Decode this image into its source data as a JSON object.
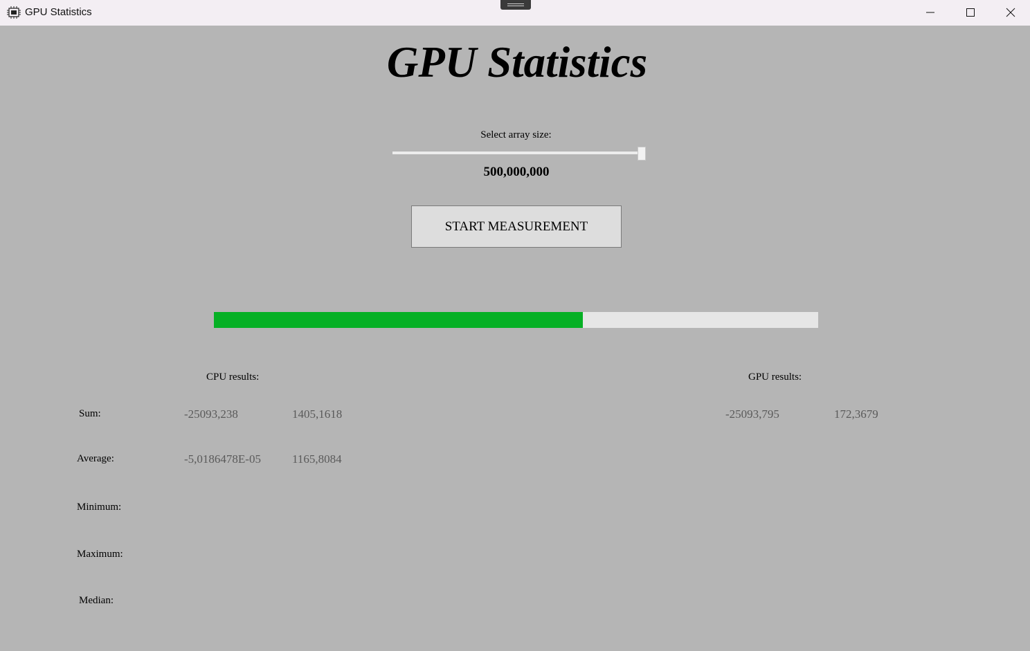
{
  "window": {
    "title": "GPU Statistics",
    "icon": "chip-icon"
  },
  "header": {
    "title": "GPU Statistics"
  },
  "array_size": {
    "label": "Select array size:",
    "value_text": "500,000,000",
    "slider_position": 0.99
  },
  "measurement": {
    "start_label": "START MEASUREMENT",
    "progress": 0.61,
    "progress_color": "#06b025"
  },
  "results": {
    "cpu_header": "CPU results:",
    "gpu_header": "GPU results:",
    "rows": [
      {
        "label": "Sum:",
        "cpu_value": "-25093,238",
        "cpu_time": "1405,1618",
        "gpu_value": "-25093,795",
        "gpu_time": "172,3679"
      },
      {
        "label": "Average:",
        "cpu_value": "-5,0186478E-05",
        "cpu_time": "1165,8084",
        "gpu_value": "",
        "gpu_time": ""
      },
      {
        "label": "Minimum:",
        "cpu_value": "",
        "cpu_time": "",
        "gpu_value": "",
        "gpu_time": ""
      },
      {
        "label": "Maximum:",
        "cpu_value": "",
        "cpu_time": "",
        "gpu_value": "",
        "gpu_time": ""
      },
      {
        "label": "Median:",
        "cpu_value": "",
        "cpu_time": "",
        "gpu_value": "",
        "gpu_time": ""
      }
    ]
  }
}
